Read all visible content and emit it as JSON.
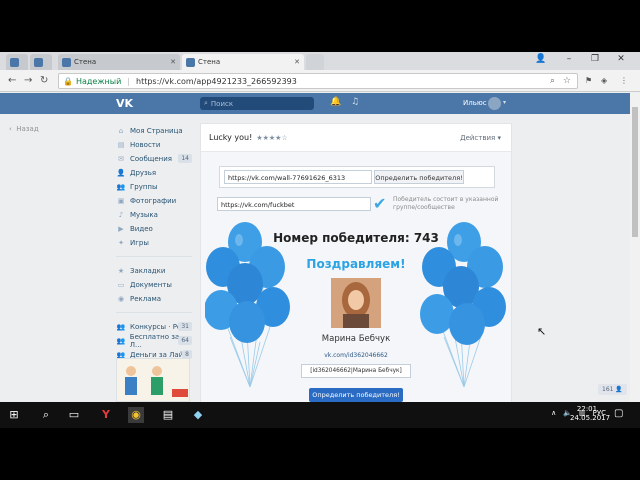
{
  "browser": {
    "tabs": [
      {
        "label": "",
        "active": false
      },
      {
        "label": "Стена",
        "active": false
      },
      {
        "label": "Стена",
        "active": true
      }
    ],
    "secure_label": "Надежный",
    "url": "https://vk.com/app4921233_266592393"
  },
  "vk": {
    "logo": "VK",
    "search_placeholder": "Поиск",
    "user_name": "Ильюс",
    "back_label": "Назад",
    "menu": [
      {
        "label": "Моя Страница",
        "icon": "home-icon",
        "count": ""
      },
      {
        "label": "Новости",
        "icon": "news-icon",
        "count": ""
      },
      {
        "label": "Сообщения",
        "icon": "message-icon",
        "count": "14"
      },
      {
        "label": "Друзья",
        "icon": "friends-icon",
        "count": ""
      },
      {
        "label": "Группы",
        "icon": "groups-icon",
        "count": ""
      },
      {
        "label": "Фотографии",
        "icon": "photo-icon",
        "count": ""
      },
      {
        "label": "Музыка",
        "icon": "music-icon",
        "count": ""
      },
      {
        "label": "Видео",
        "icon": "video-icon",
        "count": ""
      },
      {
        "label": "Игры",
        "icon": "games-icon",
        "count": ""
      }
    ],
    "menu2": [
      {
        "label": "Закладки",
        "icon": "star-icon"
      },
      {
        "label": "Документы",
        "icon": "docs-icon"
      },
      {
        "label": "Реклама",
        "icon": "ads-icon"
      }
    ],
    "menu3": [
      {
        "label": "Конкурсы · Роз...",
        "count": "31"
      },
      {
        "label": "Бесплатно за Л...",
        "count": "64"
      },
      {
        "label": "Деньги за Лайк",
        "count": "8"
      }
    ],
    "counter": "161"
  },
  "app": {
    "title": "Lucky you!",
    "stars": "★★★★☆",
    "actions_label": "Действия",
    "wall_url": "https://vk.com/wall-77691626_6313",
    "determine_label": "Определить победителя!",
    "group_url": "https://vk.com/fuckbet",
    "condition_label": "Победитель состоит в указанной группе/сообществе",
    "winner_title": "Номер победителя: 743",
    "congrats": "Поздравляем!",
    "winner_name": "Марина Бебчук",
    "winner_link": "vk.com/id362046662",
    "winner_code": "[id362046662|Марина Бебчук]",
    "determine_label2": "Определить победителя!"
  },
  "taskbar": {
    "lang": "РУС",
    "time": "22:01",
    "date": "24.05.2017"
  }
}
